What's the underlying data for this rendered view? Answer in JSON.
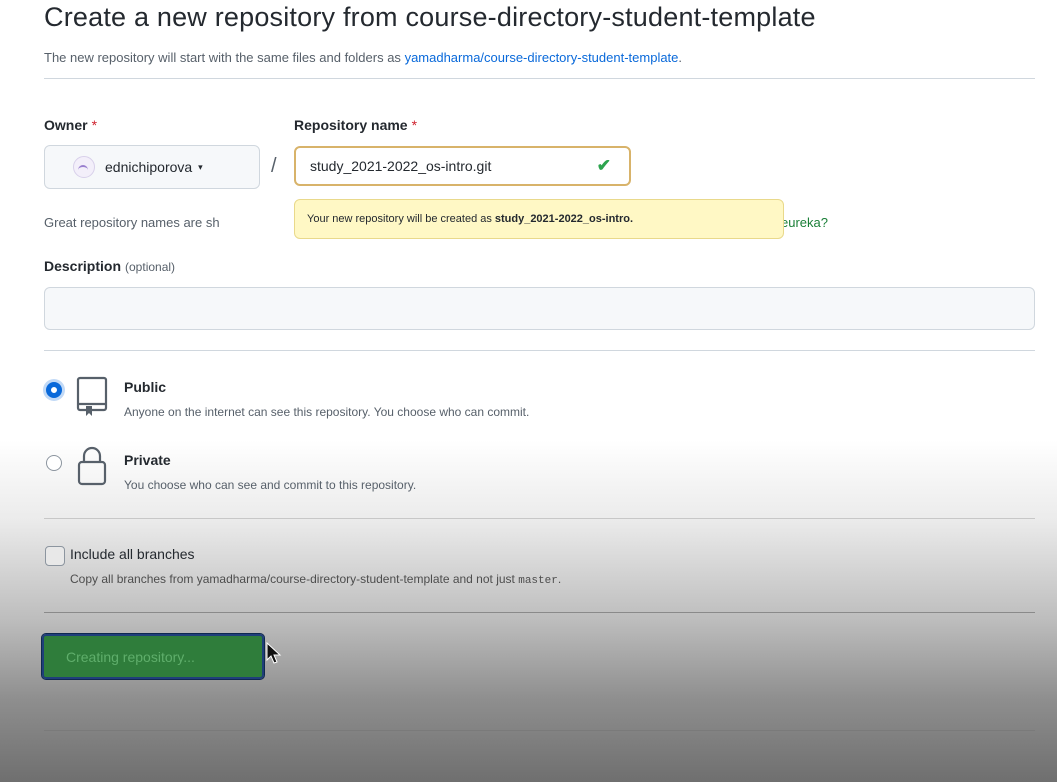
{
  "header": {
    "title": "Create a new repository from course-directory-student-template",
    "subtitle_prefix": "The new repository will start with the same files and folders as",
    "template_link": "yamadharma/course-directory-student-template",
    "subtitle_suffix": "."
  },
  "owner": {
    "label": "Owner",
    "required_mark": "*",
    "value": "ednichiporova",
    "caret": "▾"
  },
  "separator": "/",
  "repo_name": {
    "label": "Repository name",
    "required_mark": "*",
    "value": "study_2021-2022_os-intro.git",
    "valid_icon": "✔"
  },
  "hint": {
    "text_visible": "Great repository names are sh",
    "text_tail": "eureka?"
  },
  "tooltip": {
    "prefix": "Your new repository will be created as",
    "name": "study_2021-2022_os-intro."
  },
  "description": {
    "label": "Description",
    "optional": "(optional)",
    "value": ""
  },
  "visibility": {
    "public": {
      "title": "Public",
      "desc": "Anyone on the internet can see this repository. You choose who can commit.",
      "selected": true
    },
    "private": {
      "title": "Private",
      "desc": "You choose who can see and commit to this repository.",
      "selected": false
    }
  },
  "branches": {
    "title": "Include all branches",
    "desc_prefix": "Copy all branches from yamadharma/course-directory-student-template and not just",
    "desc_code": "master",
    "desc_suffix": ".",
    "checked": false
  },
  "submit": {
    "label": "Creating repository..."
  },
  "colors": {
    "accent": "#0969da",
    "success": "#2da44e",
    "button": "#2f7d3b",
    "tooltip_bg": "#fff8c5"
  }
}
